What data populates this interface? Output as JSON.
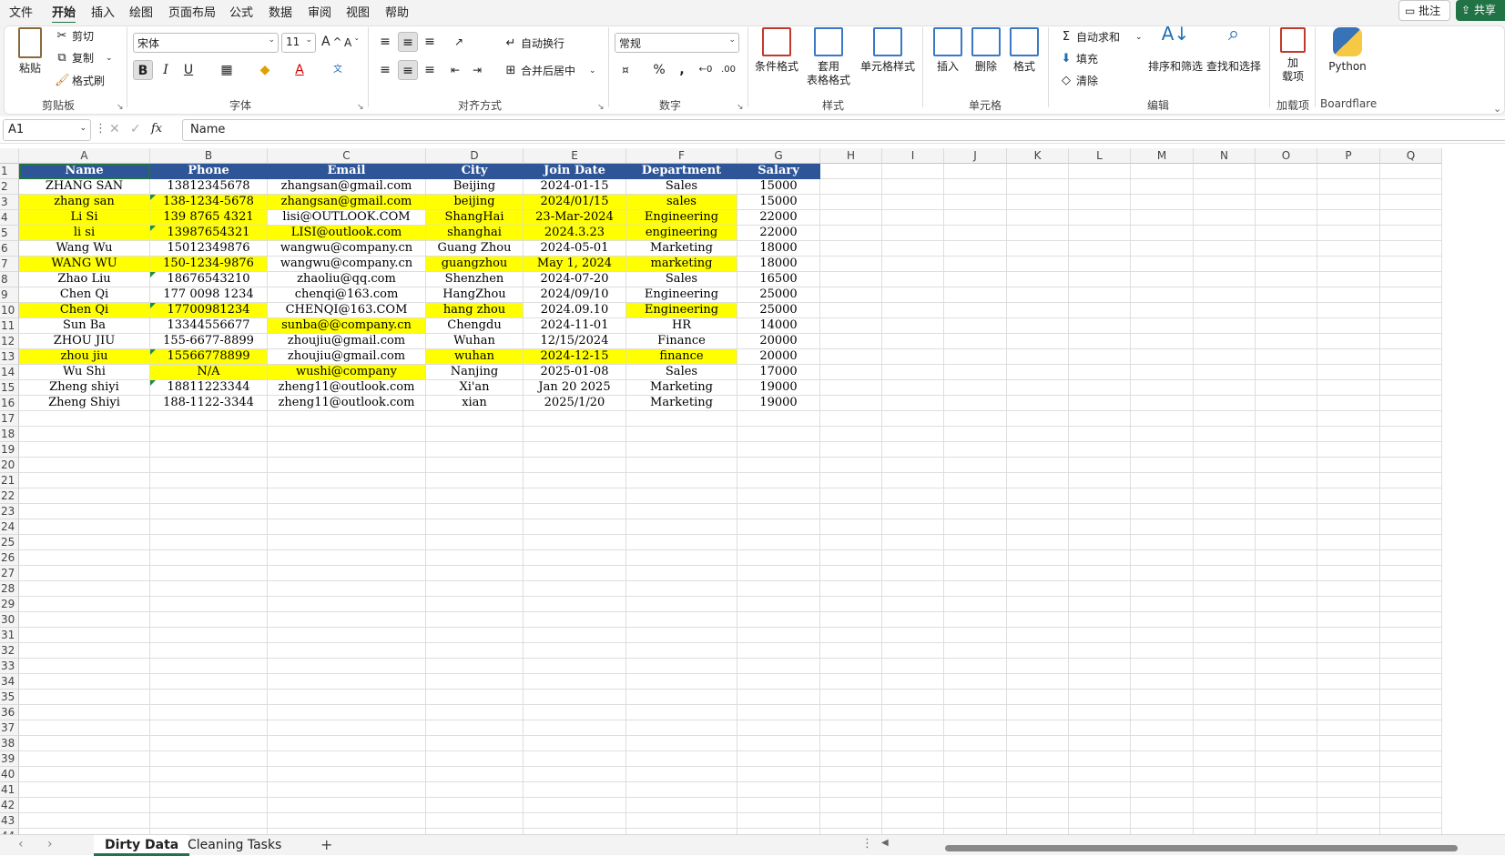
{
  "menu": [
    "文件",
    "开始",
    "插入",
    "绘图",
    "页面布局",
    "公式",
    "数据",
    "审阅",
    "视图",
    "帮助"
  ],
  "top_buttons": {
    "comment": "批注",
    "share": "共享"
  },
  "ribbon": {
    "clipboard": {
      "paste": "粘贴",
      "cut": "剪切",
      "copy": "复制",
      "format_painter": "格式刷",
      "label": "剪贴板"
    },
    "font": {
      "name": "宋体",
      "size": "11",
      "label": "字体",
      "bold": "B",
      "italic": "I",
      "underline": "U",
      "grow": "A",
      "shrink": "A"
    },
    "alignment": {
      "wrap": "自动换行",
      "merge": "合并后居中",
      "label": "对齐方式"
    },
    "number": {
      "format": "常规",
      "label": "数字",
      "percent": "%",
      "comma": ","
    },
    "styles": {
      "conditional": "条件格式",
      "table_line1": "套用",
      "table_line2": "表格格式",
      "cell_styles": "单元格样式",
      "label": "样式"
    },
    "cells": {
      "insert": "插入",
      "delete": "删除",
      "format": "格式",
      "label": "单元格"
    },
    "editing": {
      "autosum": "自动求和",
      "fill": "填充",
      "clear": "清除",
      "sort": "排序和筛选",
      "find": "查找和选择",
      "label": "编辑"
    },
    "addins": {
      "line1": "加",
      "line2": "载项",
      "label": "加载项"
    },
    "python": {
      "name": "Python",
      "label": "Boardflare"
    }
  },
  "formula_bar": {
    "name_box": "A1",
    "fx": "fx",
    "value": "Name"
  },
  "columns": [
    "A",
    "B",
    "C",
    "D",
    "E",
    "F",
    "G",
    "H",
    "I",
    "J",
    "K",
    "L",
    "M",
    "N",
    "O",
    "P",
    "Q"
  ],
  "headers": [
    "Name",
    "Phone",
    "Email",
    "City",
    "Join Date",
    "Department",
    "Salary"
  ],
  "rows": [
    [
      "ZHANG SAN",
      "13812345678",
      "zhangsan@gmail.com",
      "Beijing",
      "2024-01-15",
      "Sales",
      "15000"
    ],
    [
      "zhang san",
      "138-1234-5678",
      "zhangsan@gmail.com",
      "beijing",
      "2024/01/15",
      "sales",
      "15000"
    ],
    [
      "Li Si",
      "139 8765 4321",
      "lisi@OUTLOOK.COM",
      "ShangHai",
      "23-Mar-2024",
      "Engineering",
      "22000"
    ],
    [
      "li si",
      "13987654321",
      "LISI@outlook.com",
      "shanghai",
      "2024.3.23",
      "engineering",
      "22000"
    ],
    [
      "Wang Wu",
      "15012349876",
      "wangwu@company.cn",
      "Guang Zhou",
      "2024-05-01",
      "Marketing",
      "18000"
    ],
    [
      "WANG WU",
      "150-1234-9876",
      "wangwu@company.cn",
      "guangzhou",
      "May 1, 2024",
      "marketing",
      "18000"
    ],
    [
      "Zhao Liu",
      "18676543210",
      "zhaoliu@qq.com",
      "Shenzhen",
      "2024-07-20",
      "Sales",
      "16500"
    ],
    [
      "Chen Qi",
      "177 0098 1234",
      "chenqi@163.com",
      "HangZhou",
      "2024/09/10",
      "Engineering",
      "25000"
    ],
    [
      "Chen Qi",
      "17700981234",
      "CHENQI@163.COM",
      "hang zhou",
      "2024.09.10",
      "Engineering",
      "25000"
    ],
    [
      "Sun Ba",
      "13344556677",
      "sunba@@company.cn",
      "Chengdu",
      "2024-11-01",
      "HR",
      "14000"
    ],
    [
      "ZHOU JIU",
      "155-6677-8899",
      "zhoujiu@gmail.com",
      "Wuhan",
      "12/15/2024",
      "Finance",
      "20000"
    ],
    [
      "zhou jiu",
      "15566778899",
      "zhoujiu@gmail.com",
      "wuhan",
      "2024-12-15",
      "finance",
      "20000"
    ],
    [
      "Wu Shi",
      "N/A",
      "wushi@company",
      "Nanjing",
      "2025-01-08",
      "Sales",
      "17000"
    ],
    [
      "Zheng shiyi",
      "18811223344",
      "zheng11@outlook.com",
      "Xi'an",
      "Jan 20 2025",
      "Marketing",
      "19000"
    ],
    [
      "Zheng Shiyi",
      "188-1122-3344",
      "zheng11@outlook.com",
      "xian",
      "2025/1/20",
      "Marketing",
      "19000"
    ]
  ],
  "highlight_color": "#ffff00",
  "header_color": "#2e5597",
  "accent_color": "#217346",
  "sheet_tabs": [
    "Dirty Data",
    "Cleaning Tasks"
  ],
  "add_sheet": "+"
}
